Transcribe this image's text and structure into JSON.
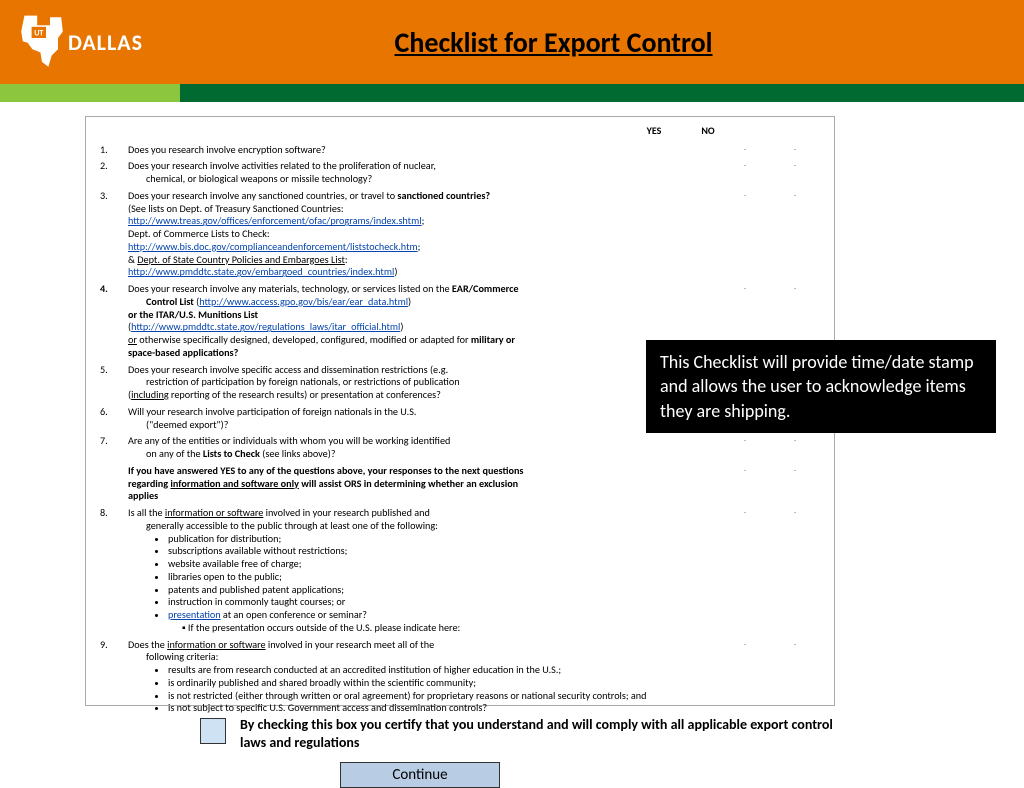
{
  "header": {
    "logo_text": "DALLAS",
    "title": "Checklist for Export Control"
  },
  "columns": {
    "yes": "YES",
    "no": "NO"
  },
  "q1": {
    "num": "1.",
    "text": "Does you research involve encryption software?"
  },
  "q2": {
    "num": "2.",
    "line1": "Does your research involve activities related to the proliferation of nuclear,",
    "line2": "chemical, or biological weapons or missile technology?"
  },
  "q3": {
    "num": "3.",
    "line1a": "Does your research involve any sanctioned countries, or travel to ",
    "line1b": "sanctioned countries?",
    "line2": "(See lists on Dept. of Treasury Sanctioned Countries:",
    "link1": "http://www.treas.gov/offices/enforcement/ofac/programs/index.shtml",
    "line3": "Dept. of Commerce Lists to Check:",
    "link2": "http://www.bis.doc.gov/complianceandenforcement/liststocheck.htm",
    "line4a": "& ",
    "line4b": "Dept. of State Country Policies and Embargoes List",
    "link3": "http://www.pmddtc.state.gov/embargoed_countries/index.html"
  },
  "q4": {
    "num": "4.",
    "line1a": "Does your research involve any materials, technology, or services listed on the ",
    "line1b": "EAR/Commerce",
    "line2a": "Control List",
    "link1": "http://www.access.gpo.gov/bis/ear/ear_data.html",
    "line3": "or the ITAR/U.S. Munitions List",
    "link2": "http://www.pmddtc.state.gov/regulations_laws/itar_official.html",
    "line4a": "or",
    "line4b": " otherwise specifically designed, developed, configured, modified or adapted for ",
    "line4c": "military or",
    "line5": "space-based applications?"
  },
  "q5": {
    "num": "5.",
    "line1": "Does your research involve specific access and dissemination restrictions (e.g.",
    "line2": "restriction of participation by foreign nationals, or restrictions of publication",
    "line3a": "(",
    "line3b": "including",
    "line3c": " reporting of the research results) or presentation at conferences?"
  },
  "q6": {
    "num": "6.",
    "line1": "Will your research involve participation of foreign nationals in the          U.S.",
    "line2": "(\"deemed export\")?"
  },
  "q7": {
    "num": "7.",
    "line1": "Are any of the entities or individuals with whom you will be working identified",
    "line2a": "on any of the ",
    "line2b": "Lists to Check",
    "line2c": " (see links above)?"
  },
  "note": {
    "line1": "If you have answered YES to any of the questions above, your responses to the next questions",
    "line2a": "regarding ",
    "line2b": "information and software only",
    "line2c": " will assist ORS in determining whether an exclusion",
    "line3": "applies"
  },
  "q8": {
    "num": "8.",
    "line1a": "Is all the ",
    "line1b": "information or software",
    "line1c": " involved in your research published and",
    "line2": "generally accessible to the public through at least one of the following:",
    "b1": "publication for distribution;",
    "b2": "subscriptions available without restrictions;",
    "b3": "website available free of charge;",
    "b4": "libraries open to the public;",
    "b5": "patents and published patent applications;",
    "b6": "instruction in commonly taught courses; or",
    "b7a": "presentation",
    "b7b": " at an open conference or seminar?",
    "sub": "▪ If the presentation occurs outside of the U.S. please indicate here:"
  },
  "q9": {
    "num": "9.",
    "line1a": "Does the ",
    "line1b": "information or software",
    "line1c": " involved in your research meet all of the",
    "line2": "following criteria:",
    "b1": "results are from research conducted at an accredited institution of higher education in the U.S.;",
    "b2": "is ordinarily published and shared broadly within the scientific community;",
    "b3": "is not restricted (either through written or oral agreement) for proprietary reasons or national security controls; and",
    "b4": "is not subject to specific U.S. Government access and dissemination controls?"
  },
  "callout": "This Checklist will provide time/date stamp and allows the user to acknowledge items they are shipping.",
  "cert": "By checking this box you certify that you understand and will comply with all applicable export control laws and regulations",
  "continue": "Continue"
}
